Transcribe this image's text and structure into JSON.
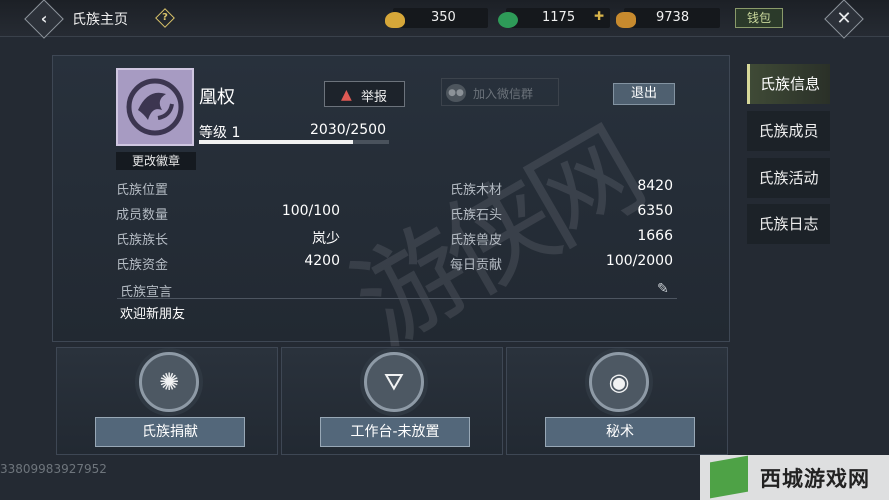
{
  "header": {
    "title": "氏族主页",
    "help": "?",
    "resources": [
      {
        "icon": "gold-bell-icon",
        "value": "350"
      },
      {
        "icon": "jade-coin-icon",
        "value": "1175"
      },
      {
        "icon": "gold-ingot-icon",
        "value": "9738"
      }
    ],
    "wallet_label": "钱包"
  },
  "clan": {
    "name": "凰权",
    "emblem_button": "更改徽章",
    "report_label": "举报",
    "wechat_label": "加入微信群",
    "logout_label": "退出",
    "level_label": "等级 1",
    "level_progress": "2030/2500",
    "level_fraction": 0.812
  },
  "stats_left": [
    {
      "label": "氏族位置",
      "value": ""
    },
    {
      "label": "成员数量",
      "value": "100/100"
    },
    {
      "label": "氏族族长",
      "value": "岚少"
    },
    {
      "label": "氏族资金",
      "value": "4200"
    }
  ],
  "stats_right": [
    {
      "label": "氏族木材",
      "value": "8420"
    },
    {
      "label": "氏族石头",
      "value": "6350"
    },
    {
      "label": "氏族兽皮",
      "value": "1666"
    },
    {
      "label": "每日贡献",
      "value": "100/2000"
    }
  ],
  "declaration": {
    "label": "氏族宣言",
    "text": "欢迎新朋友"
  },
  "cards": [
    {
      "icon": "donate-swirl-icon",
      "button": "氏族捐献"
    },
    {
      "icon": "workbench-icon",
      "button": "工作台-未放置"
    },
    {
      "icon": "secret-art-icon",
      "button": "秘术"
    }
  ],
  "side_tabs": [
    "氏族信息",
    "氏族成员",
    "氏族活动",
    "氏族日志"
  ],
  "footer_id": "33809983927952",
  "site_logo_text": "西城游戏网"
}
